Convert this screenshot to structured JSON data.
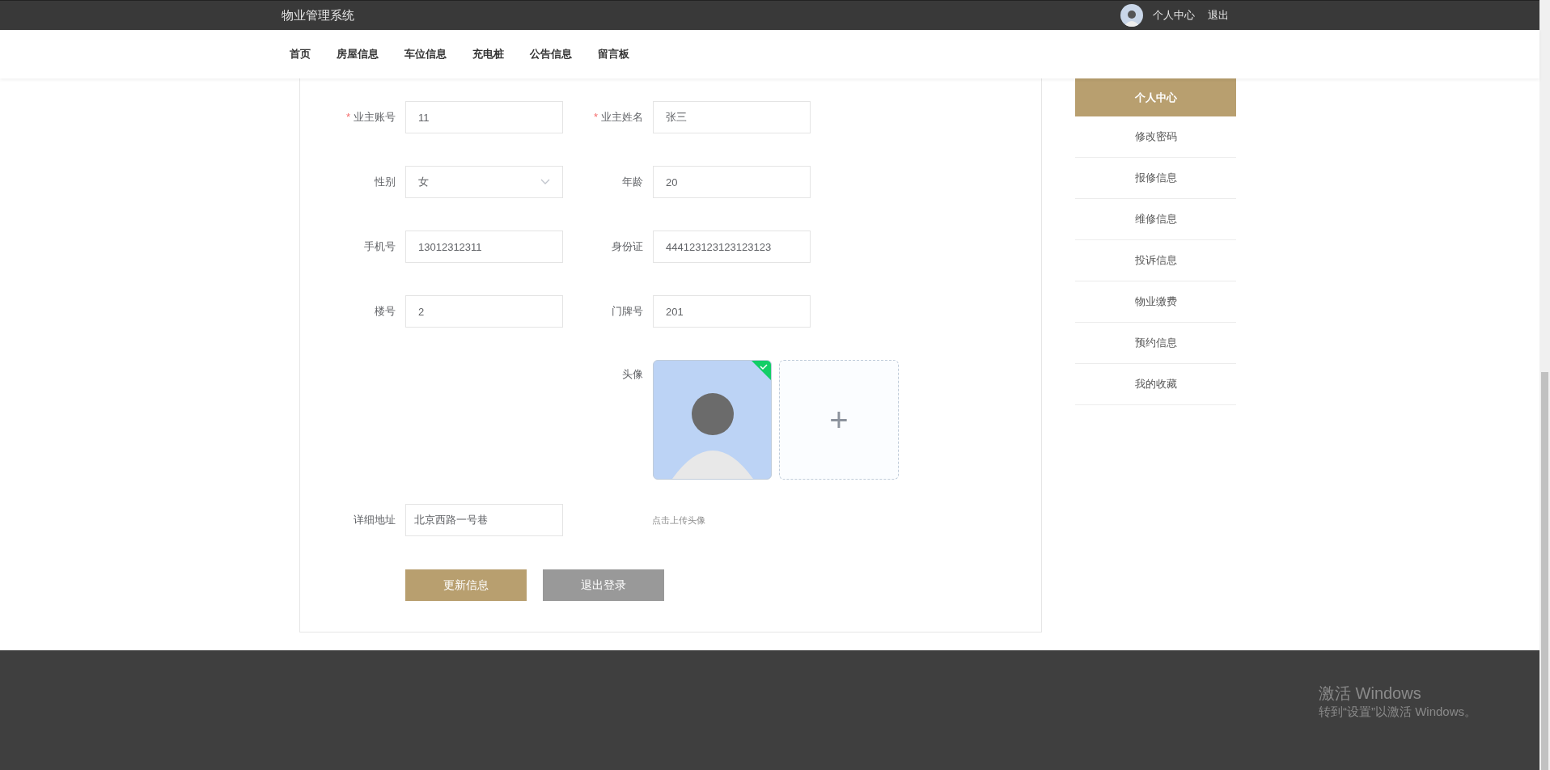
{
  "header": {
    "title": "物业管理系统",
    "user_links": [
      "个人中心",
      "退出"
    ]
  },
  "nav": {
    "items": [
      "首页",
      "房屋信息",
      "车位信息",
      "充电桩",
      "公告信息",
      "留言板"
    ]
  },
  "form": {
    "required_mark": "*",
    "rows": [
      {
        "fields": [
          {
            "kind": "text",
            "label": "业主账号",
            "required": true,
            "value": "11"
          },
          {
            "kind": "text",
            "label": "业主姓名",
            "required": true,
            "value": "张三"
          }
        ]
      },
      {
        "fields": [
          {
            "kind": "select",
            "label": "性别",
            "required": false,
            "value": "女"
          },
          {
            "kind": "text",
            "label": "年龄",
            "required": false,
            "value": "20"
          }
        ]
      },
      {
        "fields": [
          {
            "kind": "text",
            "label": "手机号",
            "required": false,
            "value": "13012312311"
          },
          {
            "kind": "text",
            "label": "身份证",
            "required": false,
            "value": "444123123123123123"
          }
        ]
      },
      {
        "fields": [
          {
            "kind": "text",
            "label": "楼号",
            "required": false,
            "value": "2"
          },
          {
            "kind": "text",
            "label": "门牌号",
            "required": false,
            "value": "201"
          }
        ]
      }
    ],
    "avatar": {
      "label": "头像",
      "uploaded": true,
      "upload_symbol": "+",
      "hint": "点击上传头像"
    },
    "address": {
      "label": "详细地址",
      "value": "北京西路一号巷"
    },
    "buttons": [
      {
        "kind": "primary",
        "label": "更新信息"
      },
      {
        "kind": "secondary",
        "label": "退出登录"
      }
    ]
  },
  "sidebar": {
    "items": [
      {
        "label": "个人中心",
        "selected": true
      },
      {
        "label": "修改密码",
        "selected": false
      },
      {
        "label": "报修信息",
        "selected": false
      },
      {
        "label": "维修信息",
        "selected": false
      },
      {
        "label": "投诉信息",
        "selected": false
      },
      {
        "label": "物业缴费",
        "selected": false
      },
      {
        "label": "预约信息",
        "selected": false
      },
      {
        "label": "我的收藏",
        "selected": false
      }
    ]
  },
  "os_notice": {
    "title": "激活 Windows",
    "message": "转到“设置”以激活 Windows。"
  }
}
